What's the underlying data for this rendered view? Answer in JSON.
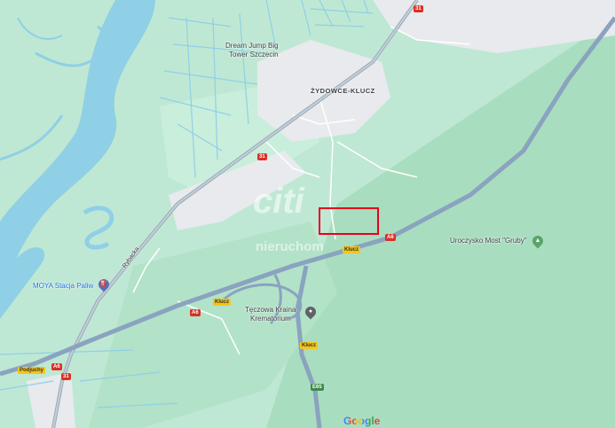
{
  "places": {
    "district": "ŻYDOWCE-KLUCZ",
    "dream_jump_line1": "Dream Jump Big",
    "dream_jump_line2": "Tower Szczecin",
    "moya": "MOYA Stacja Paliw",
    "uroczysko": "Uroczysko Most \"Gruby\"",
    "teczowa_line1": "Tęczowa Kraina",
    "teczowa_line2": "Krematorium",
    "street_rybacka": "Rybacka"
  },
  "shields": {
    "road31_top": "31",
    "road31_mid": "31",
    "road31_bottom": "31",
    "a6_right": "A6",
    "a6_mid": "A6",
    "a6_left": "A6",
    "klucz_1": "Klucz",
    "klucz_2": "Klucz",
    "klucz_3": "Klucz",
    "podjuchy": "Podjuchy",
    "e65": "E65"
  },
  "watermark": {
    "top": "citi",
    "bottom": "nieruchom"
  },
  "attribution": {
    "google": "Google"
  },
  "colors": {
    "land": "#bfe8d4",
    "forest": "#a6dcbd",
    "water": "#8fd0e6",
    "urban": "#e8eaed",
    "motorway": "#8aa3bf",
    "selection": "#e8001c"
  }
}
